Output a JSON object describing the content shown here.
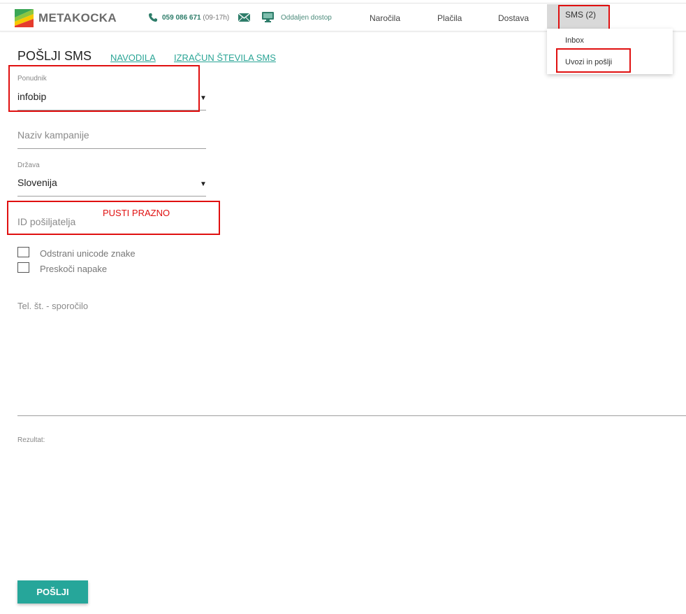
{
  "header": {
    "logo_text": "METAKOCKA",
    "phone_number": "059 086 671",
    "phone_hours": "(09-17h)",
    "remote_access": "Oddaljen dostop",
    "nav": {
      "orders": "Naročila",
      "payments": "Plačila",
      "delivery": "Dostava",
      "sms": "SMS (2)"
    },
    "sms_dropdown": [
      "Inbox",
      "Uvozi in pošlji"
    ]
  },
  "page": {
    "title": "POŠLJI SMS",
    "link_instructions": "NAVODILA",
    "link_sms_count": "IZRAČUN ŠTEVILA SMS"
  },
  "form": {
    "provider_label": "Ponudnik",
    "provider_value": "infobip",
    "campaign_placeholder": "Naziv kampanije",
    "country_label": "Država",
    "country_value": "Slovenija",
    "sender_id_placeholder": "ID pošiljatelja",
    "checkbox_unicode": "Odstrani unicode znake",
    "checkbox_skip_errors": "Preskoči napake",
    "message_placeholder": "Tel. št. - sporočilo",
    "result_label": "Rezultat:",
    "send_button": "POŠLJI"
  },
  "annotation": {
    "note": "PUSTI PRAZNO"
  },
  "colors": {
    "accent": "#26a69a",
    "annotation": "#e01010",
    "link": "#2aa596"
  }
}
